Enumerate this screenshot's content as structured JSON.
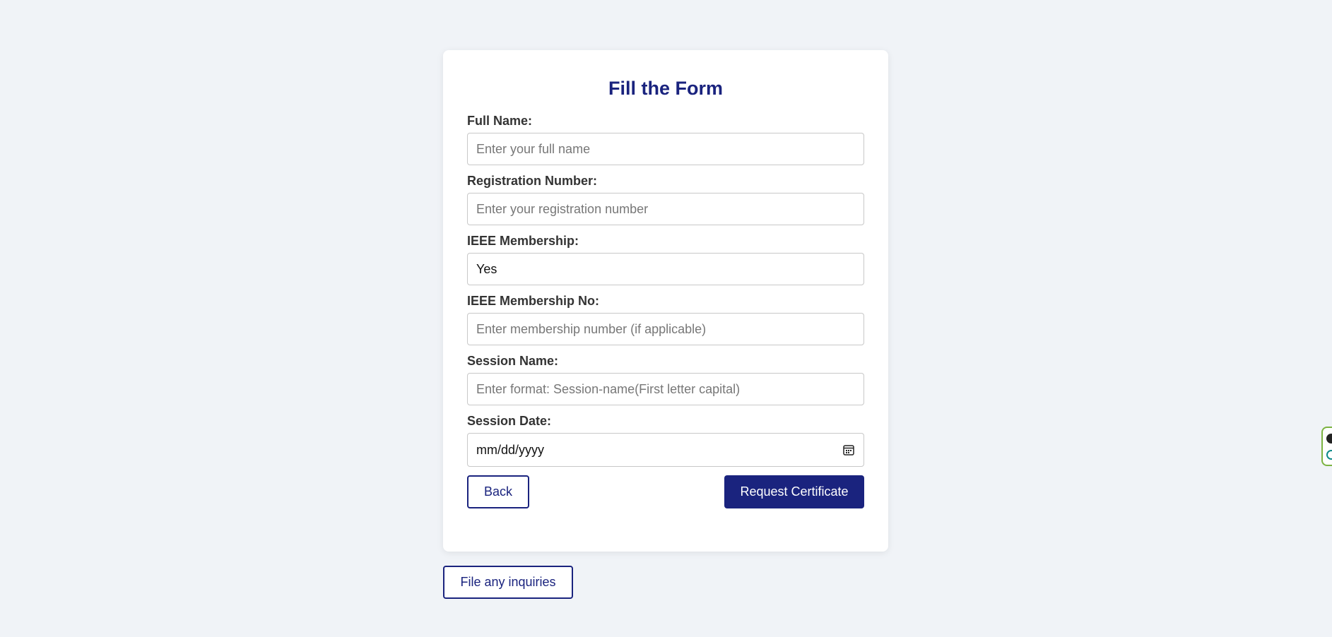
{
  "form": {
    "title": "Fill the Form",
    "fields": {
      "full_name": {
        "label": "Full Name:",
        "placeholder": "Enter your full name",
        "value": ""
      },
      "registration_number": {
        "label": "Registration Number:",
        "placeholder": "Enter your registration number",
        "value": ""
      },
      "ieee_membership": {
        "label": "IEEE Membership:",
        "value": "Yes"
      },
      "ieee_membership_no": {
        "label": "IEEE Membership No:",
        "placeholder": "Enter membership number (if applicable)",
        "value": ""
      },
      "session_name": {
        "label": "Session Name:",
        "placeholder": "Enter format: Session-name(First letter capital)",
        "value": ""
      },
      "session_date": {
        "label": "Session Date:",
        "value": "mm/dd/yyyy"
      }
    },
    "buttons": {
      "back_label": "Back",
      "submit_label": "Request Certificate"
    }
  },
  "inquiry": {
    "label": "File any inquiries"
  },
  "colors": {
    "accent": "#1a237e",
    "background": "#f0f3f7",
    "card": "#ffffff",
    "widget_border": "#7cb342"
  },
  "icons": {
    "date_picker": "calendar-icon"
  }
}
